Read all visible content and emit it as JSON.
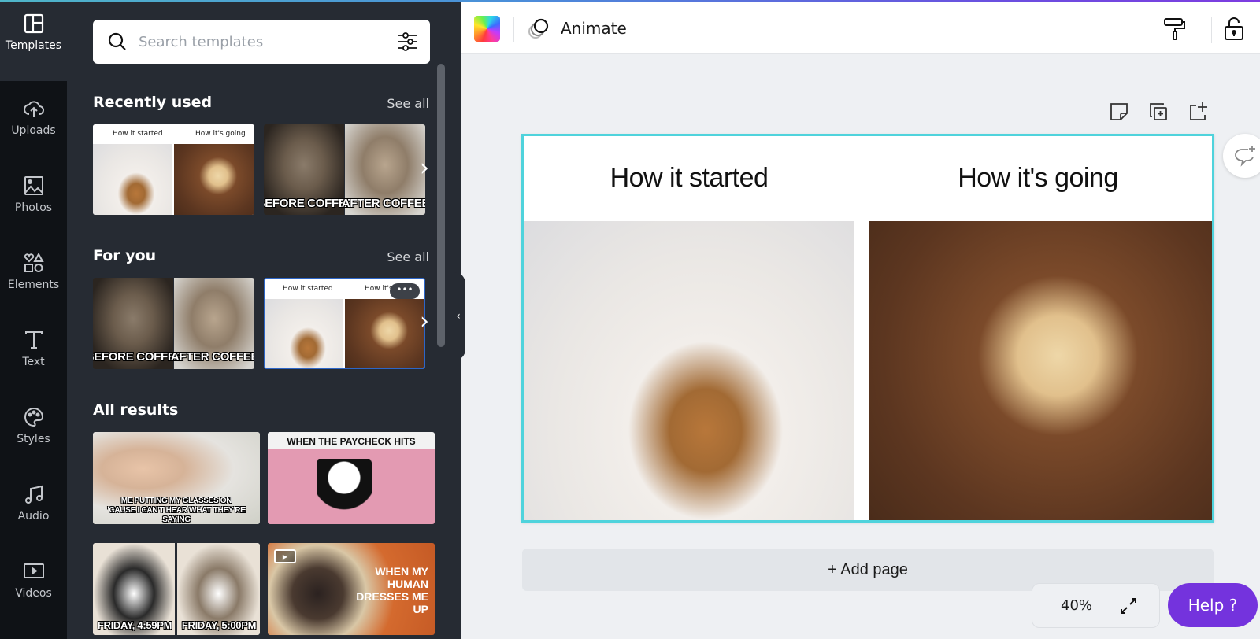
{
  "rail": {
    "items": [
      {
        "label": "Templates",
        "icon": "templates-icon",
        "active": true
      },
      {
        "label": "Uploads",
        "icon": "upload-cloud-icon"
      },
      {
        "label": "Photos",
        "icon": "photo-icon"
      },
      {
        "label": "Elements",
        "icon": "shapes-icon"
      },
      {
        "label": "Text",
        "icon": "text-icon"
      },
      {
        "label": "Styles",
        "icon": "palette-icon"
      },
      {
        "label": "Audio",
        "icon": "music-note-icon"
      },
      {
        "label": "Videos",
        "icon": "video-icon"
      }
    ]
  },
  "panel": {
    "search": {
      "placeholder": "Search templates",
      "value": ""
    },
    "sections": {
      "recent": {
        "title": "Recently used",
        "see_all": "See all"
      },
      "for_you": {
        "title": "For you",
        "see_all": "See all"
      },
      "all": {
        "title": "All results"
      }
    },
    "recent_items": [
      {
        "left_caption": "How it started",
        "right_caption": "How it's going"
      },
      {
        "left_caption": "BEFORE COFFEE",
        "right_caption": "AFTER COFFEE"
      }
    ],
    "for_you_items": [
      {
        "left_caption": "BEFORE COFFEE",
        "right_caption": "AFTER COFFEE"
      },
      {
        "left_caption": "How it started",
        "right_caption": "How it's going",
        "more_label": "•••"
      }
    ],
    "results": [
      {
        "caption": "ME PUTTING MY GLASSES ON 'CAUSE I CAN'T HEAR WHAT THEY'RE SAYING"
      },
      {
        "caption": "WHEN THE PAYCHECK HITS",
        "video": true
      },
      {
        "left_caption": "FRIDAY, 4:59PM",
        "right_caption": "FRIDAY, 5:00PM"
      },
      {
        "caption": "WHEN MY HUMAN DRESSES ME UP",
        "video": true
      }
    ]
  },
  "toolbar": {
    "animate_label": "Animate"
  },
  "canvas": {
    "left_title": "How it started",
    "right_title": "How it's going",
    "add_page_label": "+ Add page",
    "zoom_level": "40%",
    "help_label": "Help  ?"
  },
  "colors": {
    "accent": "#7433dd",
    "selection": "#4fd3dc",
    "panel_bg": "#262b33",
    "rail_bg": "#0f1216"
  }
}
